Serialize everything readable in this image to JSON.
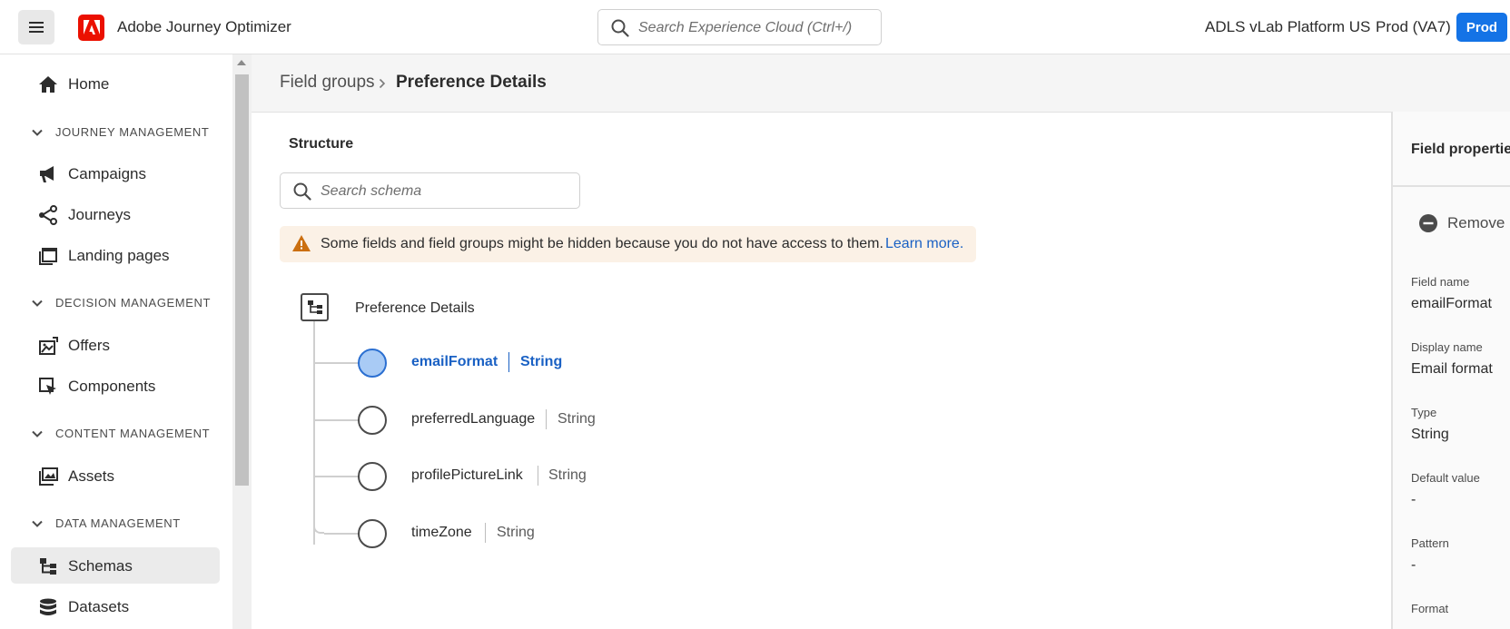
{
  "header": {
    "app_title": "Adobe Journey Optimizer",
    "search_placeholder": "Search Experience Cloud (Ctrl+/)",
    "org_name": "ADLS vLab Platform US",
    "sandbox": "Prod (VA7)",
    "env_badge": "Prod",
    "brand_color": "#eb1000",
    "accent_color": "#1473e6"
  },
  "sidebar": {
    "home": "Home",
    "sections": [
      {
        "label": "JOURNEY MANAGEMENT",
        "items": [
          "Campaigns",
          "Journeys",
          "Landing pages"
        ]
      },
      {
        "label": "DECISION MANAGEMENT",
        "items": [
          "Offers",
          "Components"
        ]
      },
      {
        "label": "CONTENT MANAGEMENT",
        "items": [
          "Assets"
        ]
      },
      {
        "label": "DATA MANAGEMENT",
        "items": [
          "Schemas",
          "Datasets"
        ]
      }
    ],
    "active_item": "Schemas"
  },
  "breadcrumb": {
    "parent": "Field groups",
    "current": "Preference Details"
  },
  "structure": {
    "title": "Structure",
    "search_placeholder": "Search schema",
    "alert_text": "Some fields and field groups might be hidden because you do not have access to them.",
    "alert_link": "Learn more.",
    "root_label": "Preference Details",
    "fields": [
      {
        "name": "emailFormat",
        "type": "String",
        "selected": true
      },
      {
        "name": "preferredLanguage",
        "type": "String",
        "selected": false
      },
      {
        "name": "profilePictureLink",
        "type": "String",
        "selected": false
      },
      {
        "name": "timeZone",
        "type": "String",
        "selected": false
      }
    ]
  },
  "field_properties": {
    "title": "Field properties",
    "remove_label": "Remove",
    "field_name_label": "Field name",
    "field_name_value": "emailFormat",
    "display_name_label": "Display name",
    "display_name_value": "Email format",
    "type_label": "Type",
    "type_value": "String",
    "default_value_label": "Default value",
    "default_value_value": "-",
    "pattern_label": "Pattern",
    "pattern_value": "-",
    "format_label": "Format"
  }
}
